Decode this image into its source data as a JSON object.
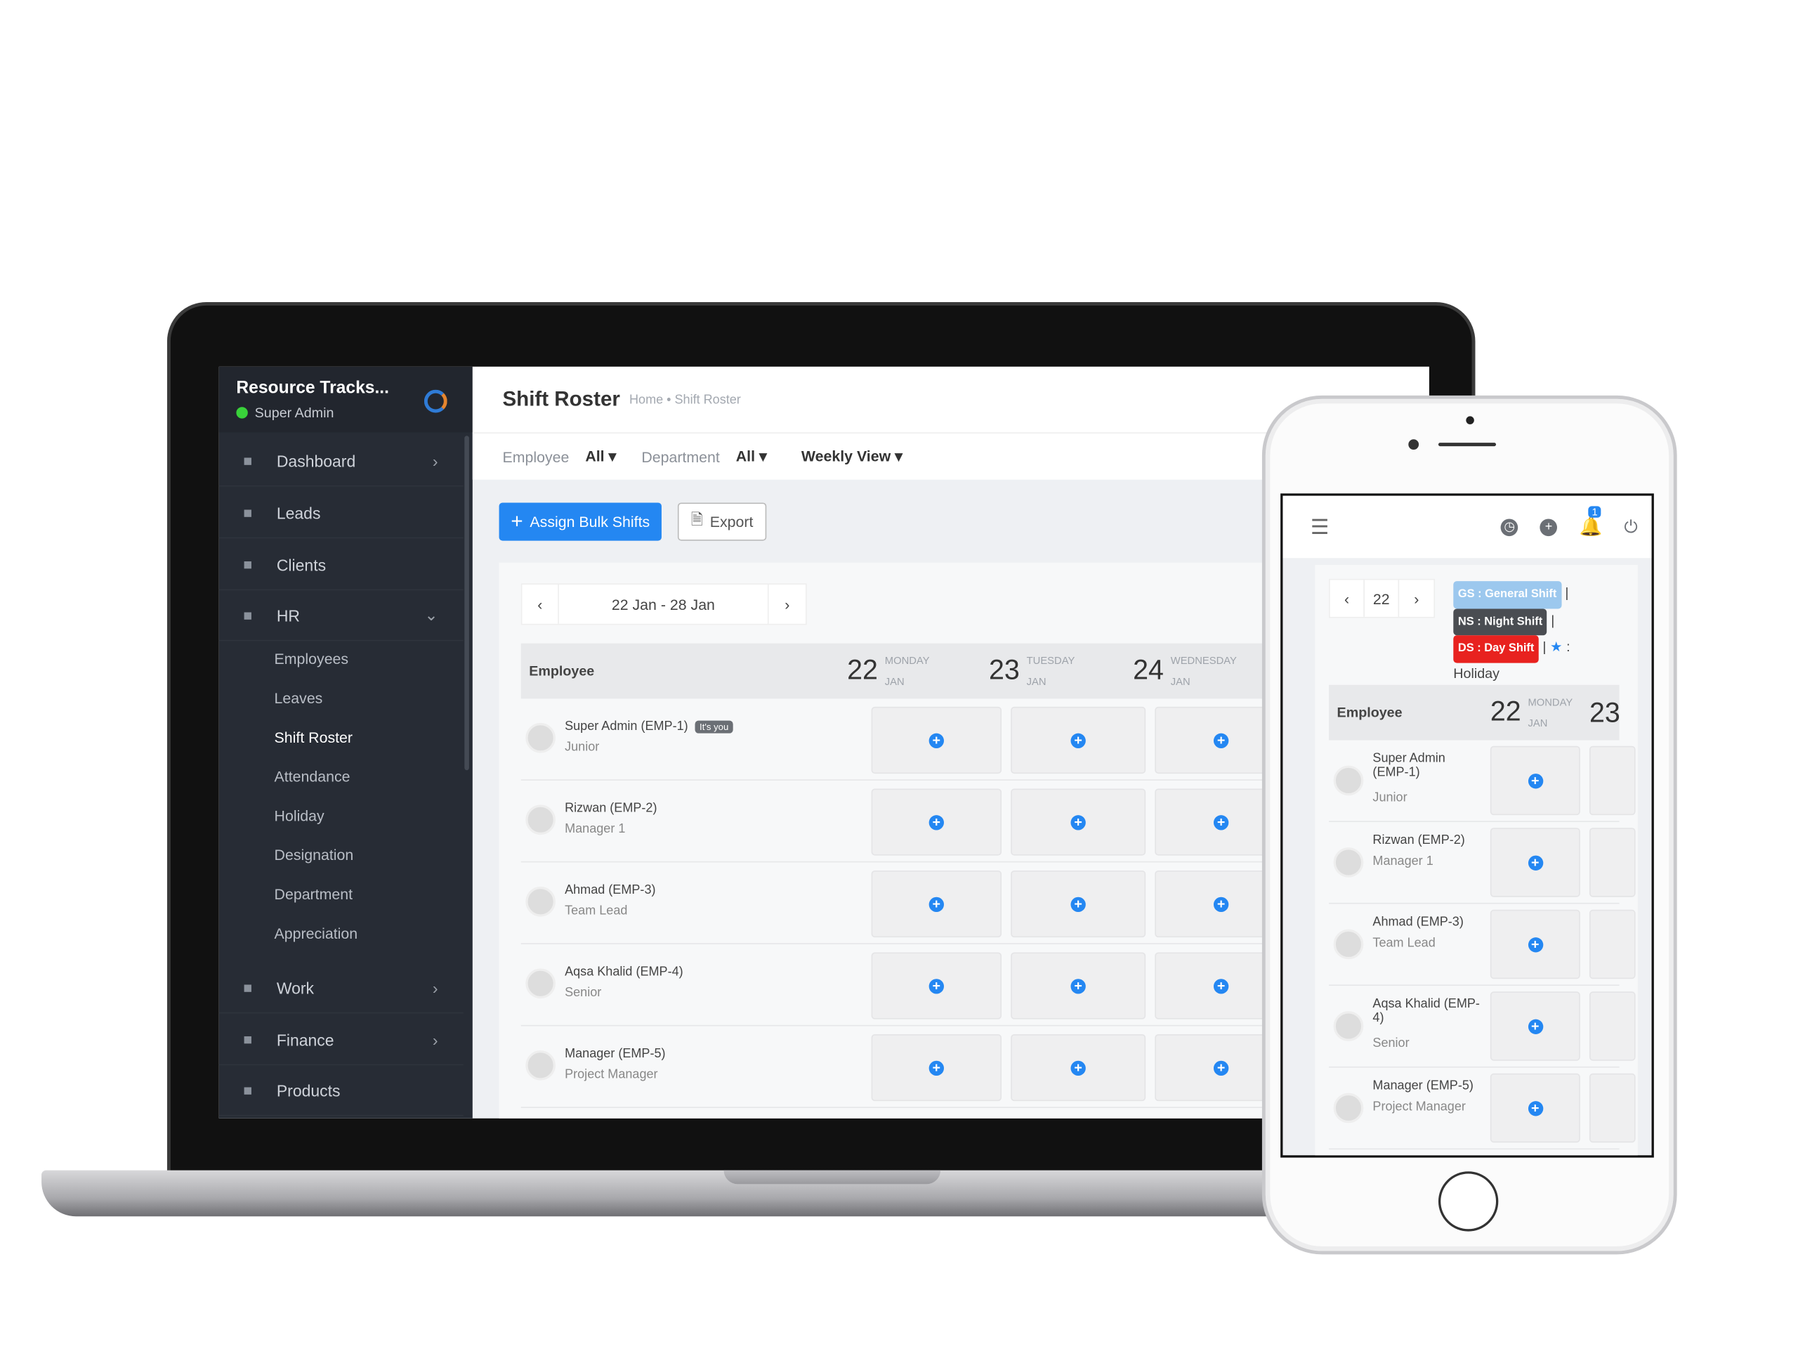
{
  "app": {
    "brand": "Resource Tracks...",
    "role": "Super Admin"
  },
  "sidebar": {
    "items": [
      {
        "label": "Dashboard",
        "icon": "home-icon",
        "chev": "›"
      },
      {
        "label": "Leads",
        "icon": "user-icon",
        "chev": ""
      },
      {
        "label": "Clients",
        "icon": "building-icon",
        "chev": ""
      },
      {
        "label": "HR",
        "icon": "users-icon",
        "chev": "⌄"
      },
      {
        "label": "Work",
        "icon": "briefcase-icon",
        "chev": "›"
      },
      {
        "label": "Finance",
        "icon": "dollar-icon",
        "chev": "›"
      },
      {
        "label": "Products",
        "icon": "basket-icon",
        "chev": ""
      }
    ],
    "hr_sub": [
      "Employees",
      "Leaves",
      "Shift Roster",
      "Attendance",
      "Holiday",
      "Designation",
      "Department",
      "Appreciation"
    ],
    "active_sub": "Shift Roster"
  },
  "header": {
    "title": "Shift Roster",
    "breadcrumb": "Home • Shift Roster"
  },
  "filters": {
    "employee_label": "Employee",
    "employee_value": "All ▾",
    "department_label": "Department",
    "department_value": "All ▾",
    "view": "Weekly View ▾"
  },
  "actions": {
    "assign": "Assign Bulk Shifts",
    "export": "Export"
  },
  "roster": {
    "range": "22 Jan - 28 Jan",
    "col_employee": "Employee",
    "days": [
      {
        "num": "22",
        "name": "MONDAY",
        "month": "JAN"
      },
      {
        "num": "23",
        "name": "TUESDAY",
        "month": "JAN"
      },
      {
        "num": "24",
        "name": "WEDNESDAY",
        "month": "JAN"
      }
    ],
    "employees": [
      {
        "name": "Super Admin (EMP-1)",
        "designation": "Junior",
        "badge": "It's you"
      },
      {
        "name": "Rizwan (EMP-2)",
        "designation": "Manager 1",
        "badge": ""
      },
      {
        "name": "Ahmad (EMP-3)",
        "designation": "Team Lead",
        "badge": ""
      },
      {
        "name": "Aqsa Khalid (EMP-4)",
        "designation": "Senior",
        "badge": ""
      },
      {
        "name": "Manager (EMP-5)",
        "designation": "Project Manager",
        "badge": ""
      }
    ]
  },
  "mobile": {
    "date": "22",
    "notifications": "1",
    "day2_num": "23",
    "legend": [
      {
        "label": "GS : General Shift",
        "color": "#9cc8ee"
      },
      {
        "label": "NS : Night Shift",
        "color": "#4a4d52"
      },
      {
        "label": "DS : Day Shift",
        "color": "#e8221f"
      }
    ],
    "holiday": "Holiday",
    "employees": [
      {
        "name": "Super Admin (EMP-1)",
        "designation": "Junior"
      },
      {
        "name": "Rizwan (EMP-2)",
        "designation": "Manager 1"
      },
      {
        "name": "Ahmad (EMP-3)",
        "designation": "Team Lead"
      },
      {
        "name": "Aqsa Khalid (EMP-4)",
        "designation": "Senior"
      },
      {
        "name": "Manager (EMP-5)",
        "designation": "Project Manager"
      }
    ]
  },
  "colors": {
    "accent": "#2487f2",
    "sidebar": "#272c35"
  }
}
